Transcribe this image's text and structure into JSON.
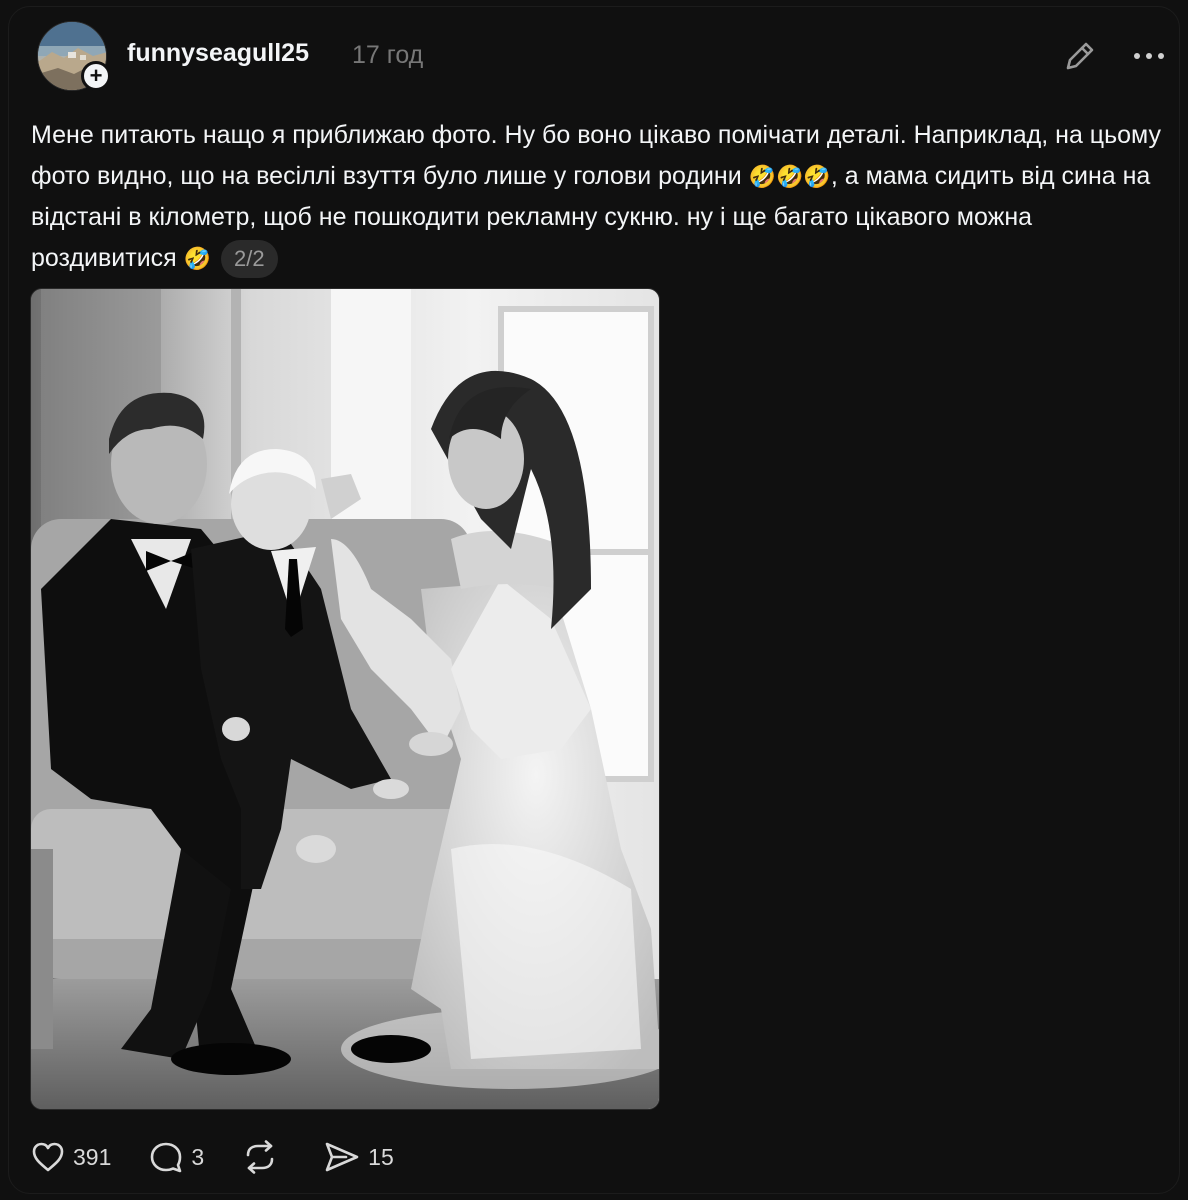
{
  "post": {
    "author": {
      "username": "funnyseagull25",
      "timestamp": "17 год",
      "follow_symbol": "+"
    },
    "text_parts": [
      "Мене питають нащо я приближаю фото. Ну бо воно цікаво помічати деталі. Наприклад, на цьому фото видно, що на весіллі взуття було лише у голови родини ",
      "🤣🤣🤣",
      ", а мама сидить від сина на відстані в кілометр, щоб не пошкодити рекламну сукню. ну і ще багато цікавого можна роздивитися ",
      "🤣"
    ],
    "carousel_counter": "2/2",
    "image": {
      "subject": "black-and-white wedding photo: groom holding toddler in tuxedo on sofa, bride in lace off-shoulder gown seated beside"
    },
    "actions": {
      "likes": "391",
      "replies": "3",
      "reposts": "",
      "shares": "15"
    },
    "icons": [
      "edit-icon",
      "more-icon",
      "heart-icon",
      "comment-icon",
      "repost-icon",
      "share-icon",
      "plus-icon"
    ]
  },
  "colors": {
    "background": "#101010",
    "text_primary": "#f3f5f7",
    "text_secondary": "#777777",
    "pill_bg": "#2a2a2a"
  }
}
